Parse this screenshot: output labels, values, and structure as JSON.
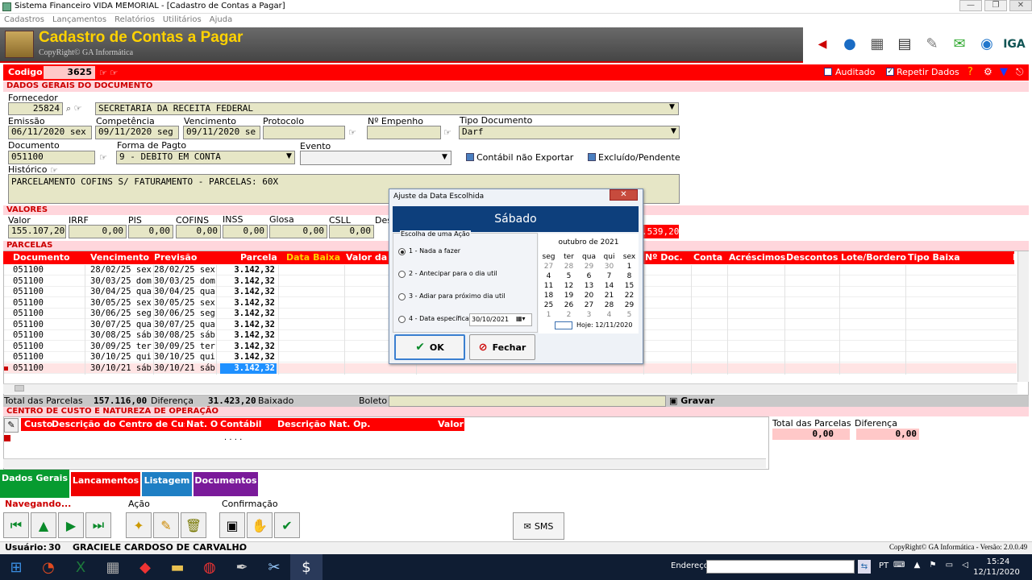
{
  "window": {
    "title": "Sistema Financeiro VIDA MEMORIAL - [Cadastro de Contas a Pagar]"
  },
  "menu": [
    "Cadastros",
    "Lançamentos",
    "Relatórios",
    "Utilitários",
    "Ajuda"
  ],
  "header": {
    "title": "Cadastro de Contas a Pagar",
    "copyright": "CopyRight© GA Informática"
  },
  "topbar": {
    "codigo_label": "Codigo",
    "codigo_value": "3625",
    "auditado_label": "Auditado",
    "auditado_checked": false,
    "repetir_label": "Repetir Dados",
    "repetir_checked": true
  },
  "dados": {
    "section_title": "DADOS GERAIS DO DOCUMENTO",
    "fornecedor_label": "Fornecedor",
    "fornecedor_code": "25824",
    "fornecedor_name": "SECRETARIA DA RECEITA FEDERAL",
    "emissao_label": "Emissão",
    "emissao": "06/11/2020 sex",
    "competencia_label": "Competência",
    "competencia": "09/11/2020 seg",
    "vencimento_label": "Vencimento",
    "vencimento": "09/11/2020 se",
    "protocolo_label": "Protocolo",
    "protocolo": "",
    "empenho_label": "Nº Empenho",
    "empenho": "",
    "tipo_doc_label": "Tipo Documento",
    "tipo_doc": "Darf",
    "documento_label": "Documento",
    "documento": "051100",
    "forma_label": "Forma de Pagto",
    "forma": "9 - DEBITO EM CONTA",
    "evento_label": "Evento",
    "evento": "",
    "contabil_label": "Contábil não Exportar",
    "excluido_label": "Excluído/Pendente",
    "historico_label": "Histórico",
    "historico": "PARCELAMENTO COFINS S/ FATURAMENTO - PARCELAS: 60X"
  },
  "valores": {
    "section_title": "VALORES",
    "labels": [
      "Valor",
      "IRRF",
      "PIS",
      "COFINS",
      "INSS",
      "Glosa",
      "CSLL",
      "Des"
    ],
    "values": [
      "155.107,20",
      "0,00",
      "0,00",
      "0,00",
      "0,00",
      "0,00",
      "0,00",
      ""
    ],
    "total_partial": ".539,20"
  },
  "parcelas": {
    "section_title": "PARCELAS",
    "columns": [
      "Documento",
      "Vencimento",
      "Previsão",
      "Parcela",
      "Data Baixa",
      "Valor da"
    ],
    "columns_right": [
      "Nº Doc.",
      "Conta",
      "Acréscimos",
      "Descontos",
      "Lote/Bordero",
      "Tipo Baixa",
      "I"
    ],
    "rows": [
      [
        "051100",
        "28/02/25 sex",
        "28/02/25 sex",
        "3.142,32"
      ],
      [
        "051100",
        "30/03/25 dom",
        "30/03/25 dom",
        "3.142,32"
      ],
      [
        "051100",
        "30/04/25 qua",
        "30/04/25 qua",
        "3.142,32"
      ],
      [
        "051100",
        "30/05/25 sex",
        "30/05/25 sex",
        "3.142,32"
      ],
      [
        "051100",
        "30/06/25 seg",
        "30/06/25 seg",
        "3.142,32"
      ],
      [
        "051100",
        "30/07/25 qua",
        "30/07/25 qua",
        "3.142,32"
      ],
      [
        "051100",
        "30/08/25 sáb",
        "30/08/25 sáb",
        "3.142,32"
      ],
      [
        "051100",
        "30/09/25 ter",
        "30/09/25 ter",
        "3.142,32"
      ],
      [
        "051100",
        "30/10/25 qui",
        "30/10/25 qui",
        "3.142,32"
      ],
      [
        "051100",
        "30/10/21 sáb",
        "30/10/21 sáb",
        "3.142,32"
      ]
    ],
    "total_label": "Total das Parcelas",
    "total": "157.116,00",
    "diferenca_label": "Diferença",
    "diferenca": "31.423,20",
    "baixado_label": "Baixado",
    "boleto_label": "Boleto",
    "gravar_label": "Gravar"
  },
  "centro": {
    "section_title": "CENTRO DE CUSTO E NATUREZA DE OPERAÇÃO",
    "columns": [
      "Custo",
      "Descrição do Centro de Cust",
      "Nat. Op",
      "Contábil",
      "Descrição Nat. Op.",
      "Valor"
    ],
    "mask": ". . . .",
    "total_label": "Total das Parcelas",
    "total": "0,00",
    "diferenca_label": "Diferença",
    "diferenca": "0,00"
  },
  "dialog": {
    "title": "Ajuste da Data Escolhida",
    "day": "Sábado",
    "group_label": "Escolha de uma Ação",
    "options": [
      "1 - Nada a fazer",
      "2 - Antecipar para o dia util",
      "3 - Adiar para próximo dia util",
      "4 - Data específica"
    ],
    "specific_date": "30/10/2021",
    "ok": "OK",
    "close": "Fechar",
    "calendar": {
      "month": "outubro de 2021",
      "weekdays": [
        "seg",
        "ter",
        "qua",
        "qui",
        "sex"
      ],
      "weeks": [
        [
          "27",
          "28",
          "29",
          "30",
          "1"
        ],
        [
          "4",
          "5",
          "6",
          "7",
          "8"
        ],
        [
          "11",
          "12",
          "13",
          "14",
          "15"
        ],
        [
          "18",
          "19",
          "20",
          "21",
          "22"
        ],
        [
          "25",
          "26",
          "27",
          "28",
          "29"
        ],
        [
          "1",
          "2",
          "3",
          "4",
          "5"
        ]
      ],
      "today": "Hoje: 12/11/2020"
    }
  },
  "tabs": [
    "Dados Gerais",
    "Lancamentos",
    "Listagem",
    "Documentos"
  ],
  "bottom": {
    "navegando": "Navegando...",
    "acao": "Ação",
    "confirmacao": "Confirmação",
    "sms": "SMS"
  },
  "status": {
    "usuario_label": "Usuário:",
    "usuario_id": "30",
    "usuario_name": "GRACIELE CARDOSO DE CARVALHO",
    "ellipsis": "...",
    "version": "CopyRight© GA Informática - Versão: 2.0.0.49"
  },
  "taskbar": {
    "endereco_label": "Endereço",
    "lang": "PT",
    "time": "15:24",
    "date": "12/11/2020"
  },
  "colors": {
    "red": "#ff0000",
    "section_bg": "#ffd6dc",
    "field_bg": "#e6e6c6",
    "dialog_header": "#0d3f7c",
    "tab_green": "#079b30",
    "tab_red": "#f00000",
    "tab_blue": "#1f7fc4",
    "tab_purple": "#7a1a9a"
  }
}
